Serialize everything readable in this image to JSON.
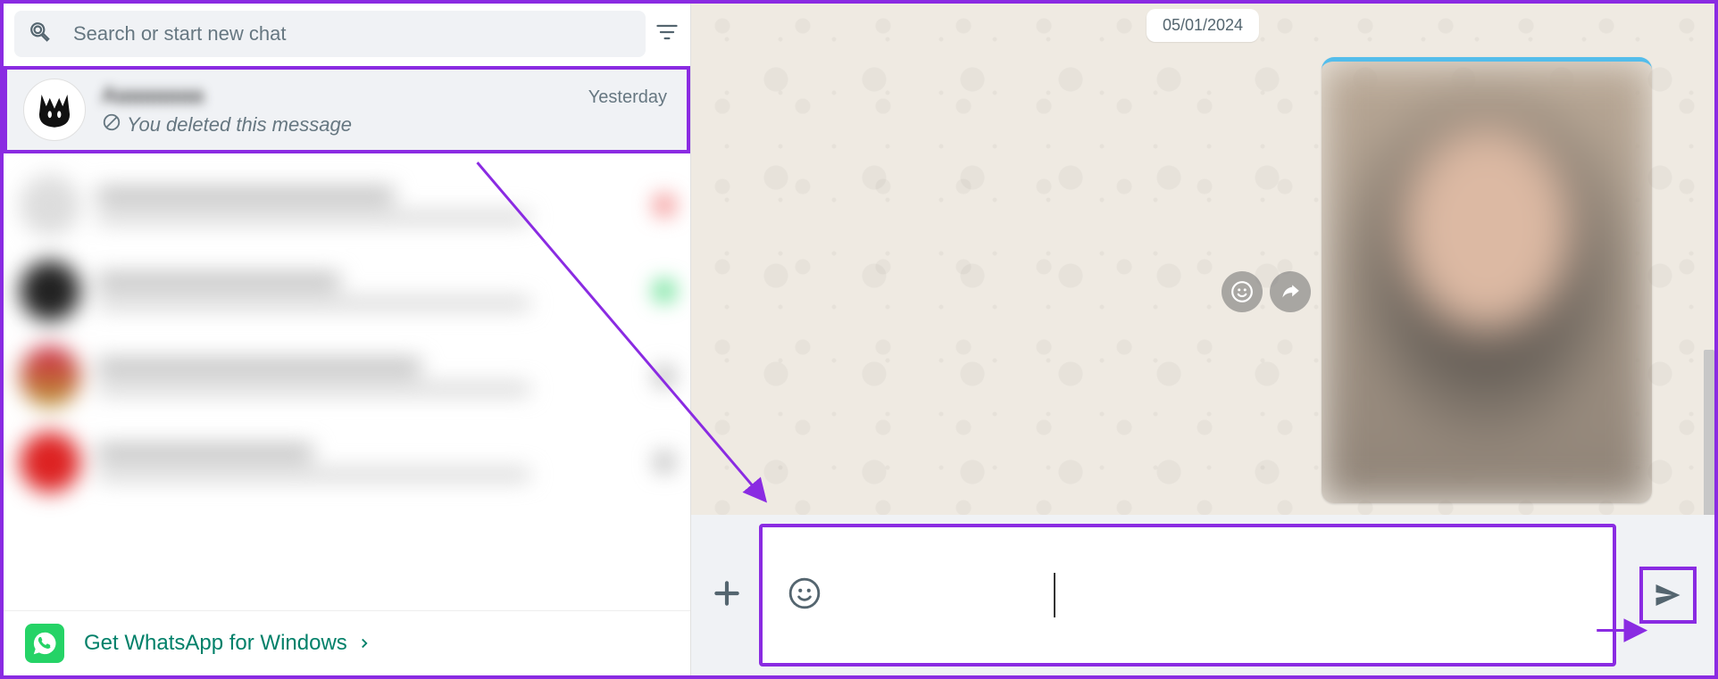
{
  "search": {
    "placeholder": "Search or start new chat"
  },
  "chat": {
    "name_visible": "A",
    "time": "Yesterday",
    "deleted_text": "You deleted this message"
  },
  "promo": {
    "text": "Get WhatsApp for Windows"
  },
  "conversation": {
    "date": "05/01/2024"
  }
}
